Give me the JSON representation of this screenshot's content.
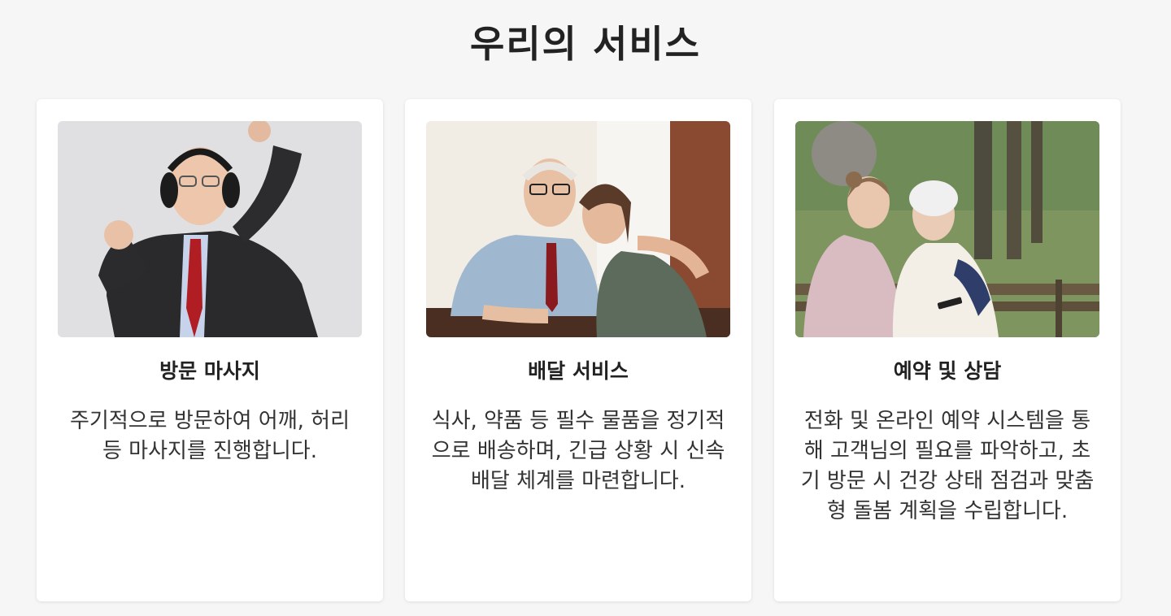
{
  "page": {
    "title": "우리의 서비스"
  },
  "services": [
    {
      "title": "방문 마사지",
      "description": "주기적으로 방문하여 어깨, 허리 등 마사지를 진행합니다.",
      "image": "elderly-man-with-headphones-photo"
    },
    {
      "title": "배달 서비스",
      "description": "식사, 약품 등 필수 물품을 정기적으로 배송하며, 긴급 상황 시 신속 배달 체계를 마련합니다.",
      "image": "elderly-man-and-young-woman-photo"
    },
    {
      "title": "예약 및 상담",
      "description": "전화 및 온라인 예약 시스템을 통해 고객님의 필요를 파악하고, 초기 방문 시 건강 상태 점검과 맞춤형 돌봄 계획을 수립합니다.",
      "image": "women-on-park-bench-photo"
    }
  ],
  "colors": {
    "background": "#f6f6f6",
    "card": "#ffffff",
    "text": "#222222"
  }
}
